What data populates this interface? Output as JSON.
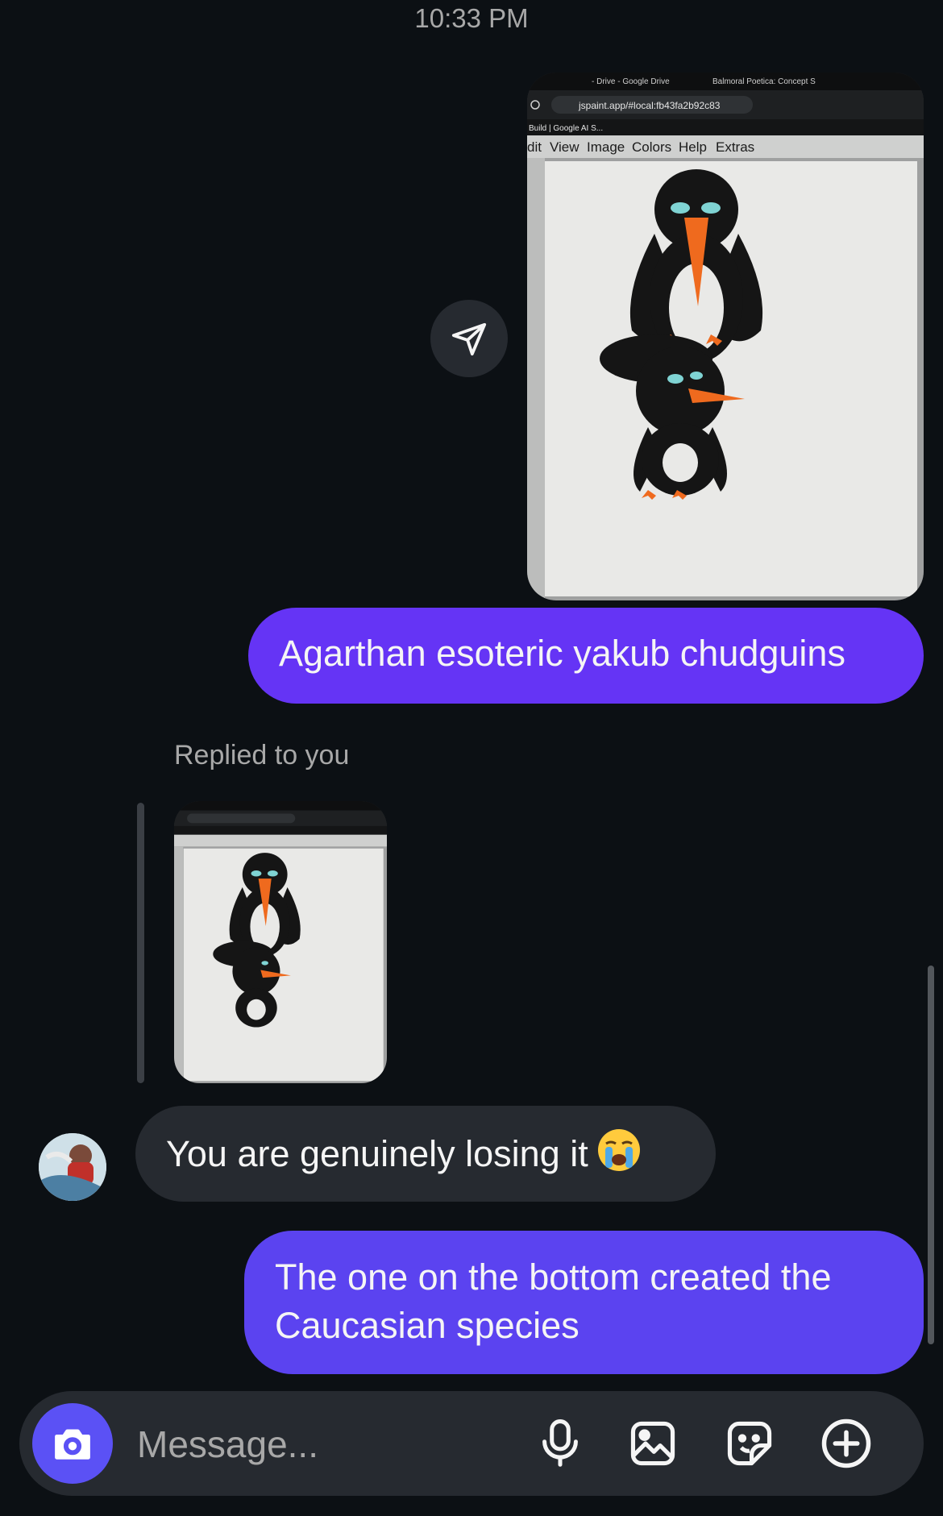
{
  "status": {
    "time": "10:33 PM"
  },
  "messages": {
    "sent_image": {
      "browser_tabs": [
        "- Drive - Google Drive",
        "Balmoral Poetica: Concept S"
      ],
      "url": "jspaint.app/#local:fb43fa2b92c83",
      "bookmark": "Build | Google AI S...",
      "menu": [
        "dit",
        "View",
        "Image",
        "Colors",
        "Help",
        "Extras"
      ]
    },
    "sent_text_1": "Agarthan esoteric yakub chudguins",
    "reply_label": "Replied to you",
    "received_text": "You are genuinely losing it",
    "sent_text_2_line1": "The one on the bottom created the",
    "sent_text_2_line2": "Caucasian species"
  },
  "composer": {
    "placeholder": "Message..."
  },
  "icons": {
    "forward": "paper-plane-icon",
    "camera": "camera-icon",
    "mic": "microphone-icon",
    "gallery": "gallery-icon",
    "sticker": "sticker-icon",
    "plus": "plus-circle-icon"
  },
  "colors": {
    "background": "#0c1014",
    "sent_bubble_1": "#6534f5",
    "sent_bubble_2": "#5b43f0",
    "received_bubble": "#262a30",
    "camera_button": "#5b51f5",
    "beak": "#ef6a1e"
  }
}
